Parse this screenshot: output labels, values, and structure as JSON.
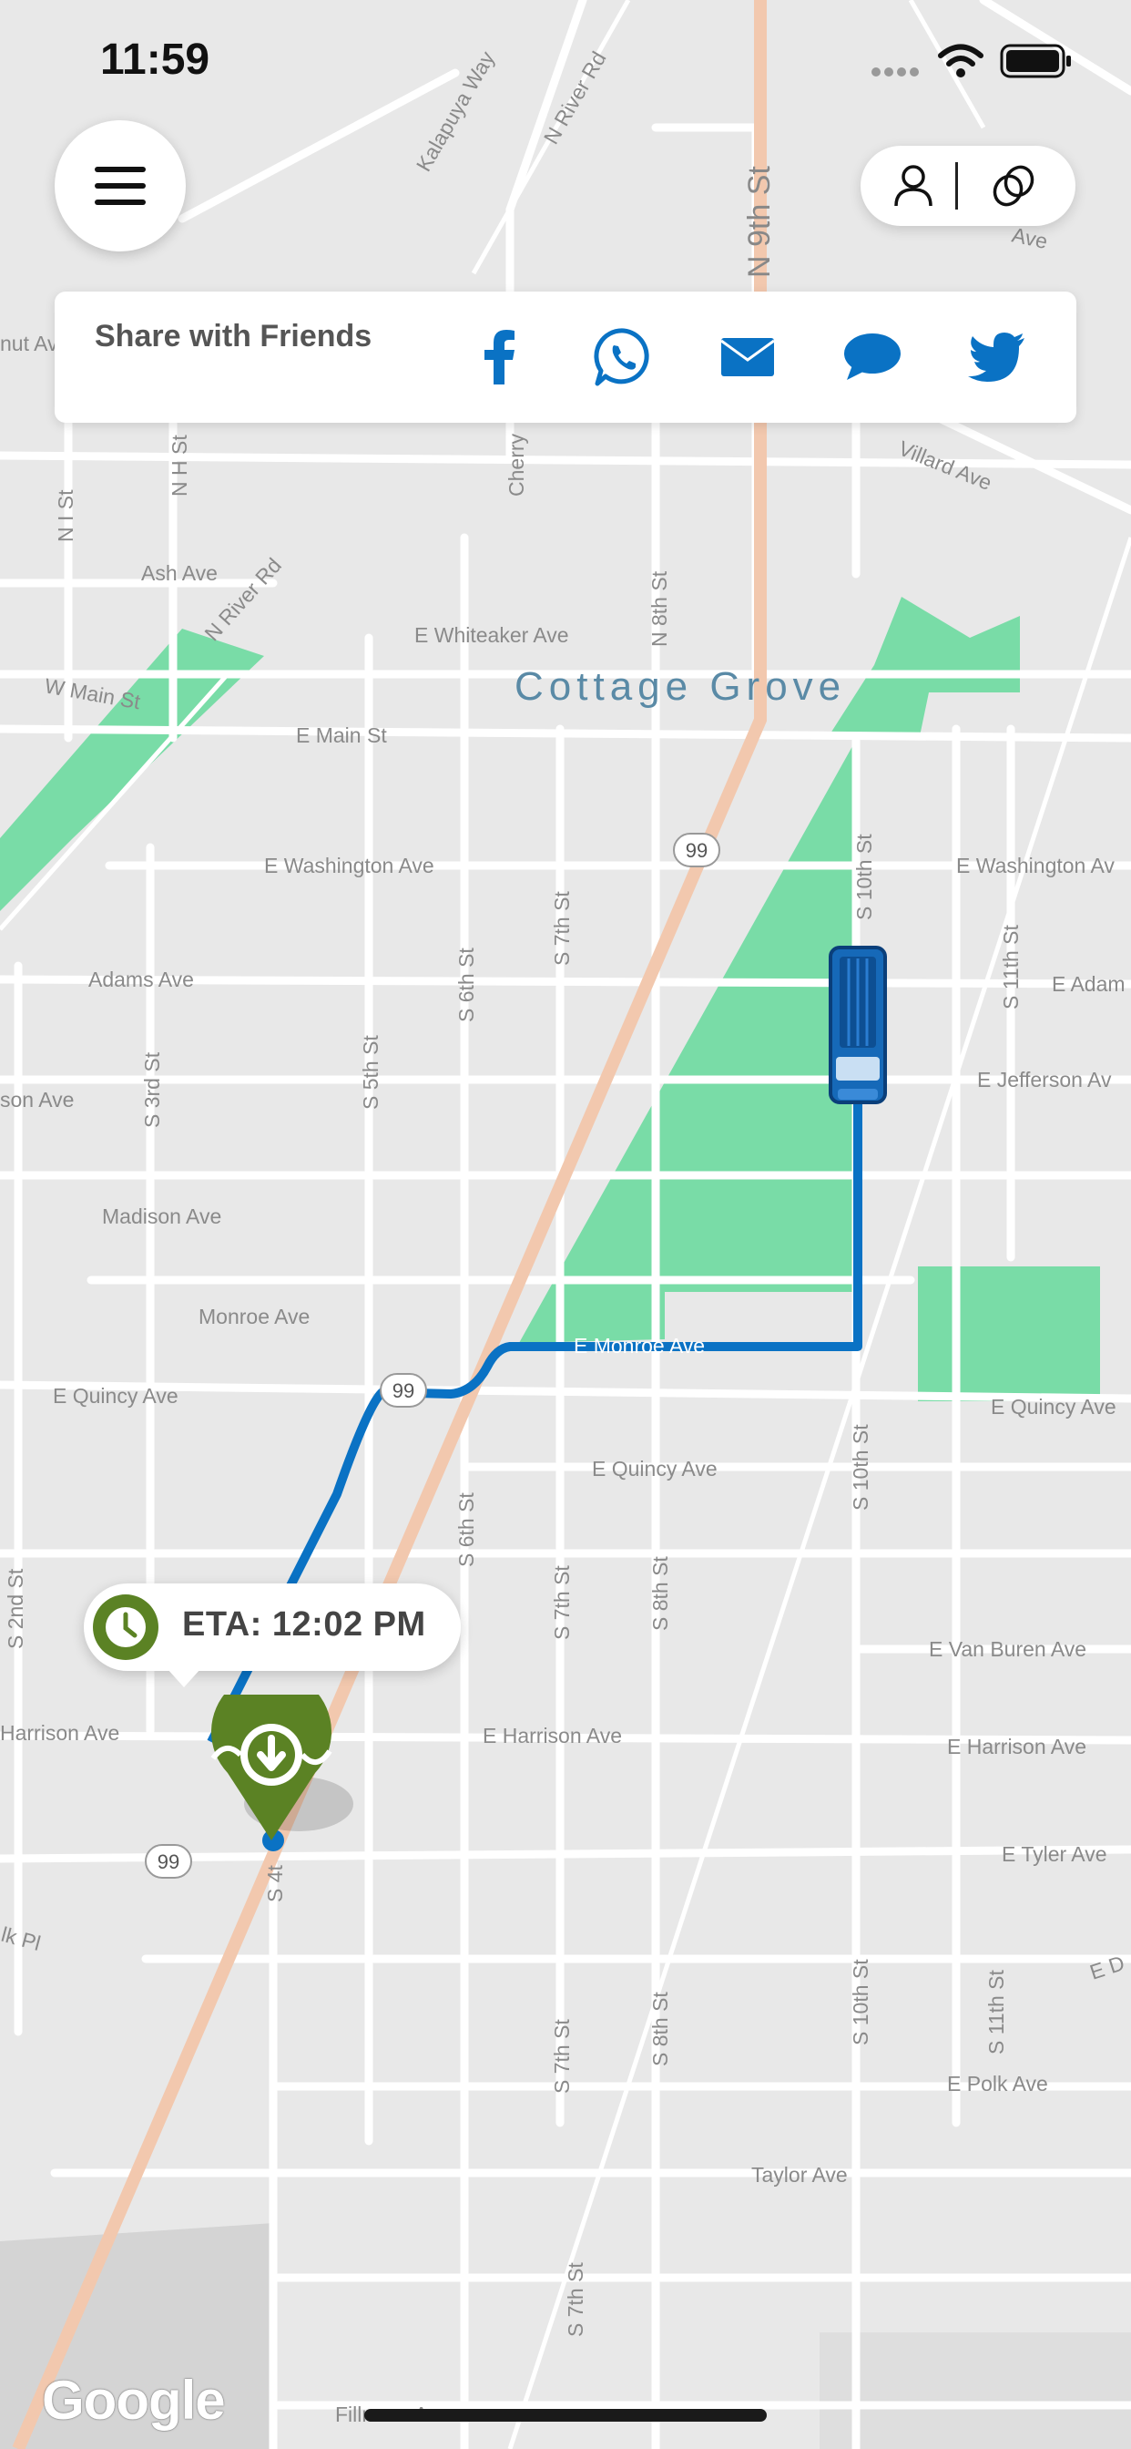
{
  "status_bar": {
    "time": "11:59"
  },
  "map": {
    "city_label": "Cottage Grove",
    "attribution": "Google",
    "route_shield": "99",
    "streets": {
      "n9th": "N 9th St",
      "kalapuya": "Kalapuya Way",
      "nriver_top": "N River Rd",
      "villard": "Villard Ave",
      "nut": "nut Ave",
      "ave_top": "Ave",
      "nh": "N H St",
      "ni": "N I St",
      "cherry": "Cherry",
      "n8th": "N 8th St",
      "ash": "Ash Ave",
      "nriver": "N River Rd",
      "whiteaker": "E Whiteaker Ave",
      "wmain": "W Main St",
      "emain": "E Main St",
      "ewash": "E Washington Ave",
      "ewash_r": "E Washington Av",
      "s10_top": "S 10th St",
      "adams": "Adams Ave",
      "s7_top": "S 7th St",
      "s6_top": "S 6th St",
      "s5": "S 5th St",
      "s3rd": "S 3rd St",
      "s11_top": "S 11th St",
      "eadam": "E Adam",
      "jefferson": "E Jefferson Av",
      "son": "son Ave",
      "madison": "Madison Ave",
      "monroe": "Monroe Ave",
      "emonroe": "E Monroe Ave",
      "equincy_l": "E Quincy Ave",
      "equincy_m": "E Quincy Ave",
      "equincy_r": "E Quincy Ave",
      "s6_mid": "S 6th St",
      "s10_mid": "S 10th St",
      "s7_mid": "S 7th St",
      "s8_mid": "S 8th St",
      "s2nd": "S 2nd St",
      "vanburen": "E Van Buren Ave",
      "harrison_l": "Harrison Ave",
      "harrison_m": "E Harrison Ave",
      "harrison_r": "E Harrison Ave",
      "tyler": "E Tyler Ave",
      "s4": "S 4t",
      "lkpl": "lk Pl",
      "s7_low": "S 7th St",
      "s8_low": "S 8th St",
      "s10_low": "S 10th St",
      "s11_low": "S 11th St",
      "ed": "E D",
      "polk": "E Polk Ave",
      "taylor": "Taylor Ave",
      "s7_bot": "S 7th St",
      "fillmore": "Fillmore Ave"
    }
  },
  "share": {
    "title": "Share with Friends"
  },
  "eta": {
    "text": "ETA: 12:02 PM"
  },
  "colors": {
    "route": "#0a72c4",
    "park": "#79dca7",
    "highway": "#f2c8ae",
    "pin": "#5b8224"
  },
  "icons": {
    "menu": "hamburger-icon",
    "profile": "user-icon",
    "rings": "rings-icon",
    "facebook": "facebook-icon",
    "whatsapp": "whatsapp-icon",
    "email": "email-icon",
    "message": "message-icon",
    "twitter": "twitter-icon",
    "clock": "clock-icon",
    "pin": "dropoff-pin-icon",
    "bus": "bus-icon"
  }
}
